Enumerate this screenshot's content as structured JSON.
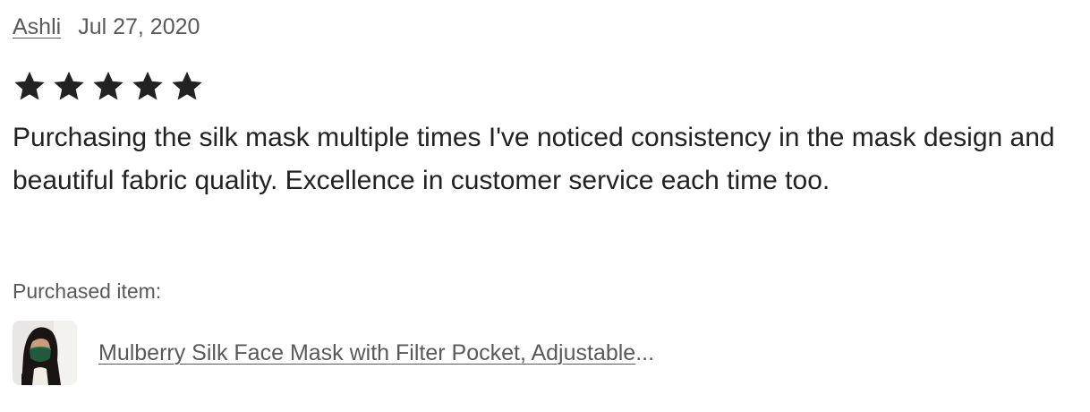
{
  "review": {
    "author": "Ashli",
    "date": "Jul 27, 2020",
    "rating": 5,
    "rating_max": 5,
    "text": "Purchasing the silk mask multiple times I've noticed consistency in the mask design and beautiful fabric quality. Excellence in customer service each time too.",
    "purchased_label": "Purchased item:",
    "item": {
      "title": "Mulberry Silk Face Mask with Filter Pocket, Adjustable",
      "ellipsis": "...",
      "thumbnail_icon": "product-photo-green-mask"
    }
  },
  "colors": {
    "text": "#222222",
    "muted": "#595959",
    "star": "#222222",
    "mask_green": "#1f5a3e"
  }
}
